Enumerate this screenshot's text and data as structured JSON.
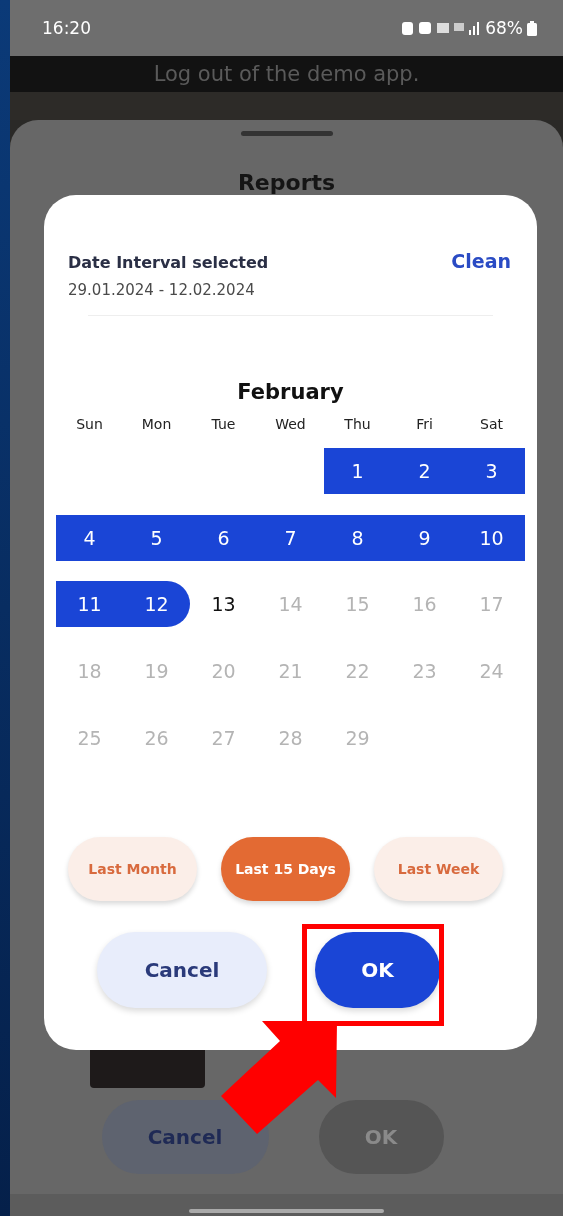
{
  "status_bar": {
    "time": "16:20",
    "battery": "68%"
  },
  "background": {
    "banner": "Log out of the demo app.",
    "sheet_title": "Reports",
    "buttons": [
      {
        "label": "Cancel",
        "disabled": false
      },
      {
        "label": "OK",
        "disabled": true
      }
    ]
  },
  "dialog": {
    "heading": "Date Interval selected",
    "clear_action": "Clean",
    "interval": "29.01.2024 - 12.02.2024",
    "month": "February",
    "weekdays": [
      "Sun",
      "Mon",
      "Tue",
      "Wed",
      "Thu",
      "Fri",
      "Sat"
    ],
    "weeks": [
      [
        {
          "kind": "blank"
        },
        {
          "kind": "blank"
        },
        {
          "kind": "blank"
        },
        {
          "kind": "blank"
        },
        {
          "kind": "day",
          "day": "1",
          "in_range": true,
          "range_end": false,
          "disabled": false
        },
        {
          "kind": "day",
          "day": "2",
          "in_range": true,
          "range_end": false,
          "disabled": false
        },
        {
          "kind": "day",
          "day": "3",
          "in_range": true,
          "range_end": false,
          "disabled": false
        }
      ],
      [
        {
          "kind": "day",
          "day": "4",
          "in_range": true,
          "range_end": false,
          "disabled": false
        },
        {
          "kind": "day",
          "day": "5",
          "in_range": true,
          "range_end": false,
          "disabled": false
        },
        {
          "kind": "day",
          "day": "6",
          "in_range": true,
          "range_end": false,
          "disabled": false
        },
        {
          "kind": "day",
          "day": "7",
          "in_range": true,
          "range_end": false,
          "disabled": false
        },
        {
          "kind": "day",
          "day": "8",
          "in_range": true,
          "range_end": false,
          "disabled": false
        },
        {
          "kind": "day",
          "day": "9",
          "in_range": true,
          "range_end": false,
          "disabled": false
        },
        {
          "kind": "day",
          "day": "10",
          "in_range": true,
          "range_end": false,
          "disabled": false
        }
      ],
      [
        {
          "kind": "day",
          "day": "11",
          "in_range": true,
          "range_end": false,
          "disabled": false
        },
        {
          "kind": "day",
          "day": "12",
          "in_range": true,
          "range_end": true,
          "disabled": false
        },
        {
          "kind": "day",
          "day": "13",
          "in_range": false,
          "range_end": false,
          "disabled": false
        },
        {
          "kind": "day",
          "day": "14",
          "in_range": false,
          "range_end": false,
          "disabled": true
        },
        {
          "kind": "day",
          "day": "15",
          "in_range": false,
          "range_end": false,
          "disabled": true
        },
        {
          "kind": "day",
          "day": "16",
          "in_range": false,
          "range_end": false,
          "disabled": true
        },
        {
          "kind": "day",
          "day": "17",
          "in_range": false,
          "range_end": false,
          "disabled": true
        }
      ],
      [
        {
          "kind": "day",
          "day": "18",
          "in_range": false,
          "range_end": false,
          "disabled": true
        },
        {
          "kind": "day",
          "day": "19",
          "in_range": false,
          "range_end": false,
          "disabled": true
        },
        {
          "kind": "day",
          "day": "20",
          "in_range": false,
          "range_end": false,
          "disabled": true
        },
        {
          "kind": "day",
          "day": "21",
          "in_range": false,
          "range_end": false,
          "disabled": true
        },
        {
          "kind": "day",
          "day": "22",
          "in_range": false,
          "range_end": false,
          "disabled": true
        },
        {
          "kind": "day",
          "day": "23",
          "in_range": false,
          "range_end": false,
          "disabled": true
        },
        {
          "kind": "day",
          "day": "24",
          "in_range": false,
          "range_end": false,
          "disabled": true
        }
      ],
      [
        {
          "kind": "day",
          "day": "25",
          "in_range": false,
          "range_end": false,
          "disabled": true
        },
        {
          "kind": "day",
          "day": "26",
          "in_range": false,
          "range_end": false,
          "disabled": true
        },
        {
          "kind": "day",
          "day": "27",
          "in_range": false,
          "range_end": false,
          "disabled": true
        },
        {
          "kind": "day",
          "day": "28",
          "in_range": false,
          "range_end": false,
          "disabled": true
        },
        {
          "kind": "day",
          "day": "29",
          "in_range": false,
          "range_end": false,
          "disabled": true
        },
        {
          "kind": "blank"
        },
        {
          "kind": "blank"
        }
      ]
    ],
    "presets": [
      {
        "label": "Last Month",
        "selected": false
      },
      {
        "label": "Last 15 Days",
        "selected": true
      },
      {
        "label": "Last Week",
        "selected": false
      }
    ],
    "buttons": [
      {
        "label": "Cancel",
        "kind": "secondary"
      },
      {
        "label": "OK",
        "kind": "primary"
      }
    ]
  }
}
